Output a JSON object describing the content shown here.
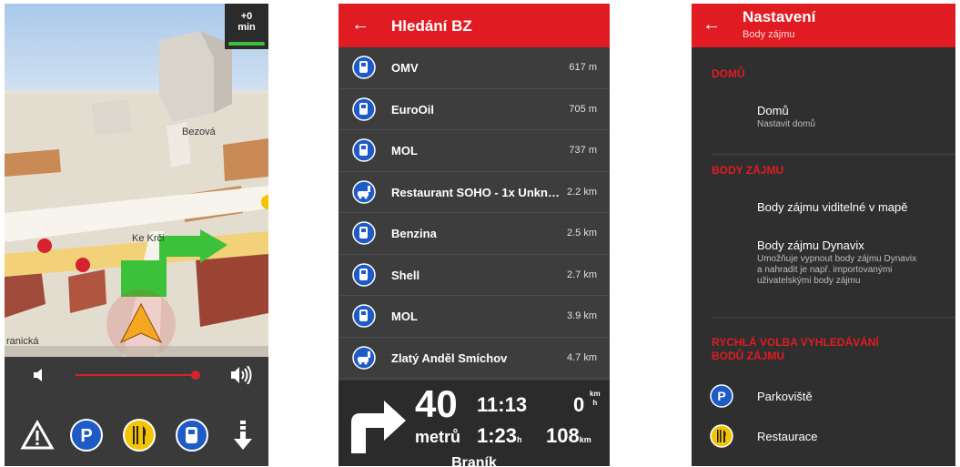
{
  "map_screen": {
    "time_delta": "+0",
    "time_unit": "min",
    "labels": {
      "bezova": "Bezová",
      "ke_krci": "Ke Krči",
      "branicka": "ranická"
    },
    "quick_buttons": [
      "warning-icon",
      "parking-icon",
      "restaurant-icon",
      "fuel-icon",
      "arrow-down-icon"
    ],
    "volume_level": 0.94
  },
  "poi_search": {
    "title": "Hledání BZ",
    "items": [
      {
        "name": "OMV",
        "distance": "617 m",
        "icon": "fuel-icon"
      },
      {
        "name": "EuroOil",
        "distance": "705 m",
        "icon": "fuel-icon"
      },
      {
        "name": "MOL",
        "distance": "737 m",
        "icon": "fuel-icon"
      },
      {
        "name": "Restaurant SOHO - 1x Unkno...",
        "distance": "2.2 km",
        "icon": "car-service-icon"
      },
      {
        "name": "Benzina",
        "distance": "2.5 km",
        "icon": "fuel-icon"
      },
      {
        "name": "Shell",
        "distance": "2.7 km",
        "icon": "fuel-icon"
      },
      {
        "name": "MOL",
        "distance": "3.9 km",
        "icon": "fuel-icon"
      },
      {
        "name": "Zlatý Anděl Smíchov",
        "distance": "4.7 km",
        "icon": "car-service-icon"
      }
    ],
    "nav": {
      "distance_value": "40",
      "distance_unit": "metrů",
      "arrival_time": "11:13",
      "speed": "0",
      "speed_unit_top": "km",
      "speed_unit_bottom": "h",
      "remaining_time": "1:23",
      "remaining_time_unit": "h",
      "remaining_distance": "108",
      "remaining_distance_unit": "km",
      "street": "Braník"
    }
  },
  "settings": {
    "title": "Nastavení",
    "subtitle": "Body zájmu",
    "section_home": "DOMŮ",
    "home_title": "Domů",
    "home_desc": "Nastavit domů",
    "section_poi": "BODY ZÁJMU",
    "poi_visible": "Body zájmu viditelné v mapě",
    "poi_dynavix_title": "Body zájmu Dynavix",
    "poi_dynavix_desc": "Umožňuje vypnout body zájmu Dynavix a nahradit je např. importovanými uživatelskými body zájmu",
    "section_quick": "RYCHLÁ VOLBA VYHLEDÁVÁNÍ BODŮ ZÁJMU",
    "quick_parking": "Parkoviště",
    "quick_restaurant": "Restaurace"
  },
  "colors": {
    "accent": "#e11b22",
    "icon_blue": "#1e5bc6",
    "icon_yellow": "#f5c400",
    "route_green": "#3cc13b"
  }
}
